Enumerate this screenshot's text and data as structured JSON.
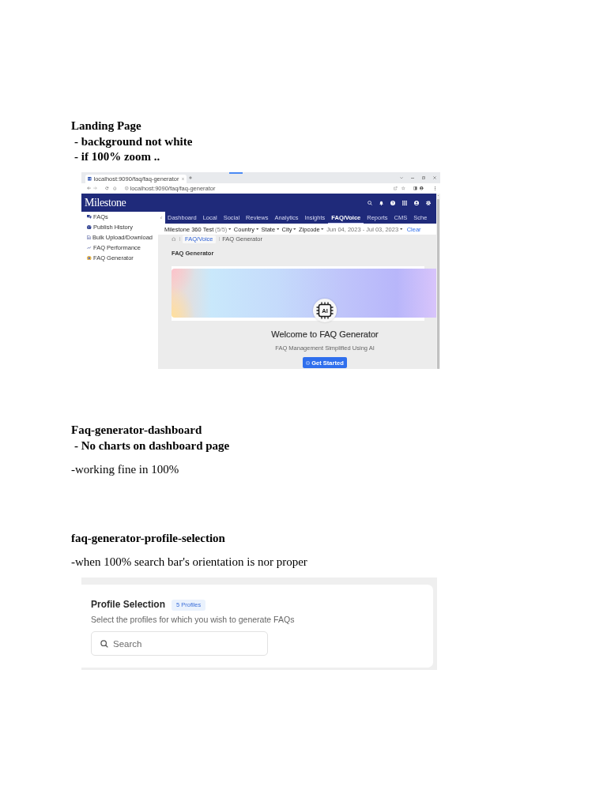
{
  "document": {
    "blocks": [
      {
        "kind": "heading",
        "text": "Landing Page"
      },
      {
        "kind": "bold_item",
        "text": "- background not white"
      },
      {
        "kind": "bold_item",
        "text": "- if 100% zoom .."
      },
      {
        "kind": "landing_screenshot",
        "browser": {
          "tab_title": "localhost:9090/faq/faq-generator",
          "url": "localhost:9090/faq/faq-generator"
        },
        "app": {
          "logo": "Milestone",
          "sidebar": [
            {
              "label": "FAQs"
            },
            {
              "label": "Publish History"
            },
            {
              "label": "Bulk Upload/Download"
            },
            {
              "label": "FAQ Performance"
            },
            {
              "label": "FAQ Generator"
            }
          ],
          "nav_tabs": [
            {
              "label": "Dashboard",
              "selected": false
            },
            {
              "label": "Local",
              "selected": false
            },
            {
              "label": "Social",
              "selected": false
            },
            {
              "label": "Reviews",
              "selected": false
            },
            {
              "label": "Analytics",
              "selected": false
            },
            {
              "label": "Insights",
              "selected": false
            },
            {
              "label": "FAQ/Voice",
              "selected": true
            },
            {
              "label": "Reports",
              "selected": false
            },
            {
              "label": "CMS",
              "selected": false
            },
            {
              "label": "Sche",
              "selected": false
            }
          ],
          "filters": [
            {
              "kind": "dropdown",
              "label": "Milestone 360 Test",
              "suffix": "(5/5)"
            },
            {
              "kind": "dropdown",
              "label": "Country"
            },
            {
              "kind": "dropdown",
              "label": "State"
            },
            {
              "kind": "dropdown",
              "label": "City"
            },
            {
              "kind": "dropdown",
              "label": "Zipcode"
            },
            {
              "kind": "date",
              "label": "Jun 04, 2023 - Jul 03, 2023"
            }
          ],
          "clear_link": "Clear",
          "breadcrumb": [
            {
              "kind": "link",
              "label": "FAQ/Voice"
            },
            {
              "kind": "current",
              "label": "FAQ Generator"
            }
          ],
          "page_title": "FAQ Generator",
          "welcome": {
            "chip_label": "AI",
            "title": "Welcome to FAQ Generator",
            "subtitle": "FAQ Management Simplified Using AI",
            "button": "Get Started"
          }
        }
      },
      {
        "kind": "heading",
        "text": "Faq-generator-dashboard"
      },
      {
        "kind": "bold_item",
        "text": "- No charts on dashboard page"
      },
      {
        "kind": "plain_item",
        "text": "-working fine in 100%"
      },
      {
        "kind": "heading",
        "text": "faq-generator-profile-selection"
      },
      {
        "kind": "plain_item",
        "text": "-when 100% search bar's orientation is nor proper"
      },
      {
        "kind": "profile_screenshot",
        "card": {
          "title": "Profile Selection",
          "badge": "5 Profiles",
          "subtitle": "Select the profiles for which you wish to generate FAQs",
          "search": {
            "placeholder": "Search"
          }
        }
      }
    ]
  }
}
